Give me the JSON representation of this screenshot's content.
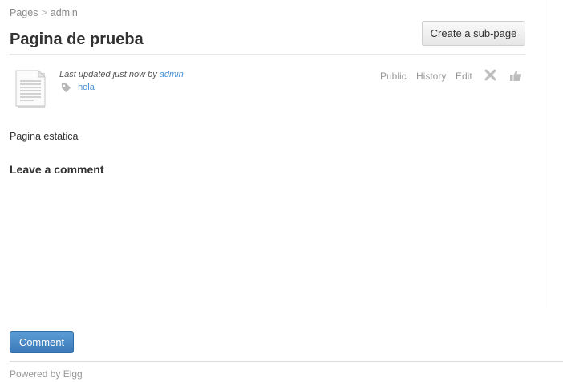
{
  "breadcrumb": {
    "items": [
      "Pages",
      "admin"
    ],
    "separator": ">"
  },
  "page": {
    "title": "Pagina de prueba"
  },
  "toolbar": {
    "create_subpage_label": "Create a sub-page"
  },
  "entity": {
    "icon": "document-icon",
    "byline_prefix": "Last updated just now by",
    "author": "admin",
    "tag_icon": "tag-icon",
    "tags": [
      "hola"
    ],
    "actions": {
      "access": "Public",
      "history": "History",
      "edit": "Edit",
      "delete_icon": "delete-icon",
      "like_icon": "thumbs-up-icon"
    },
    "body": "Pagina estatica"
  },
  "comments": {
    "heading": "Leave a comment",
    "submit_label": "Comment"
  },
  "footer": {
    "text": "Powered by Elgg"
  },
  "colors": {
    "link": "#4690d6",
    "button_primary": "#3b7ab8",
    "muted": "#999999"
  }
}
